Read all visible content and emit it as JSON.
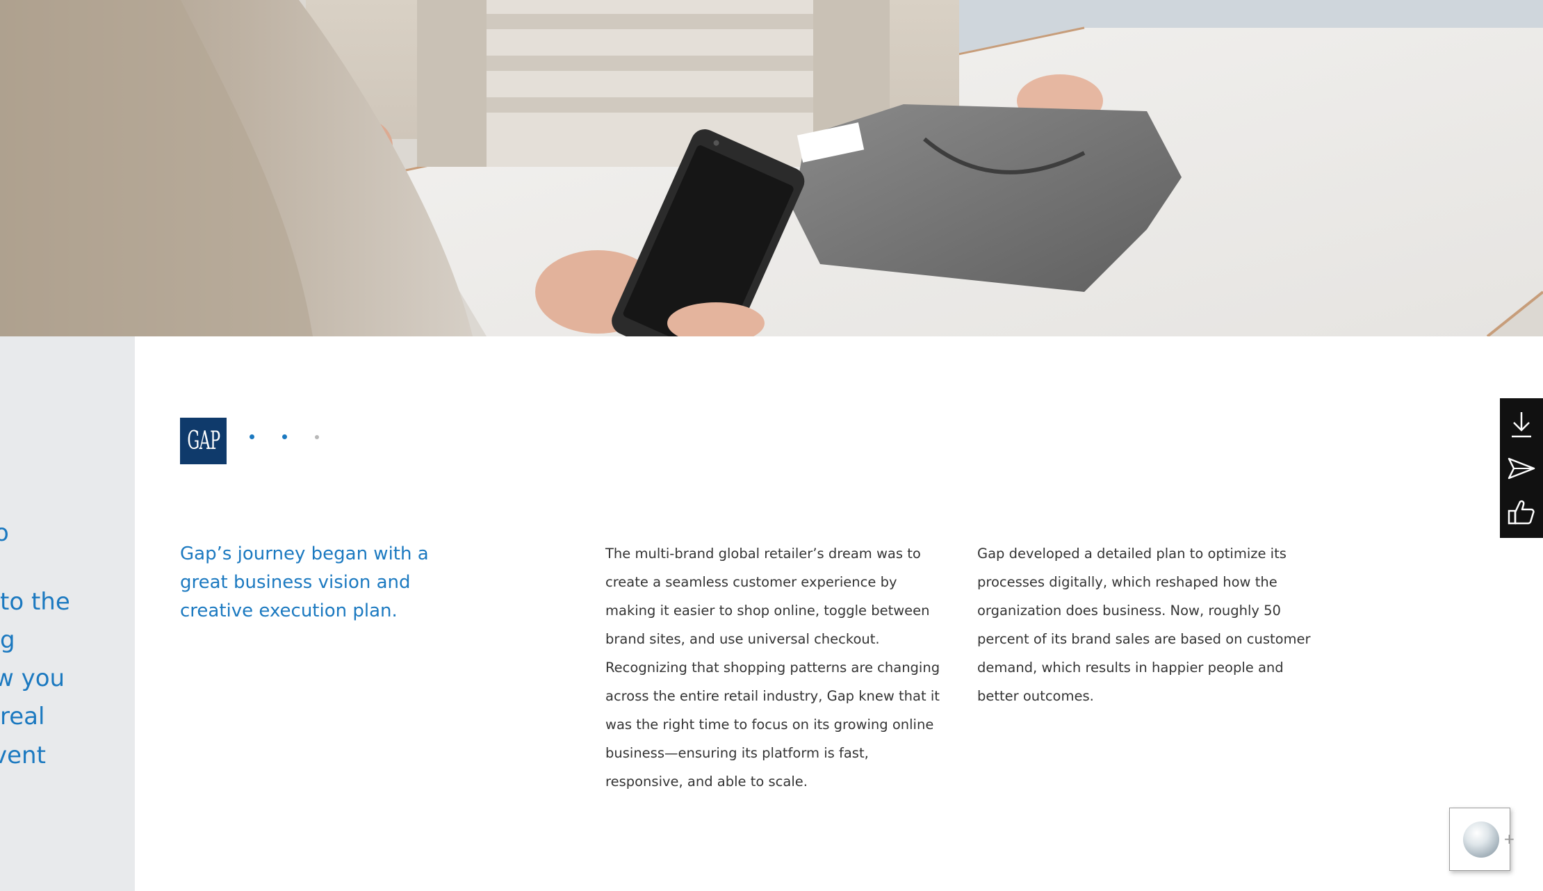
{
  "hero": {
    "alt": "Customer paying with phone at counter next to folded grey shirt"
  },
  "side_panel": {
    "lines": [
      "o",
      " to the",
      "g",
      "w you",
      "real",
      "vent"
    ]
  },
  "logo": {
    "text": "GAP",
    "bg_color": "#0f3a6b"
  },
  "carousel": {
    "dots": [
      {
        "active": true,
        "color": "#1b79c0"
      },
      {
        "active": true,
        "color": "#1b79c0"
      },
      {
        "active": false,
        "color": "#b8b8b8"
      }
    ]
  },
  "content": {
    "lead": "Gap’s journey began with a great business vision and creative execution plan.",
    "paragraph_1": "The multi-brand global retailer’s dream was to create a seamless customer experience by making it easier to shop online, toggle between brand sites, and use universal checkout. Recognizing that shopping patterns are changing across the entire retail industry, Gap knew that it was the right time to focus on its growing online business—ensuring its platform is fast, responsive, and able to scale.",
    "paragraph_2": "Gap developed a detailed plan to optimize its processes digitally, which reshaped how the organization does business. Now, roughly 50 percent of its brand sales are based on customer demand, which results in happier people and better outcomes."
  },
  "rail": {
    "items": [
      "download-icon",
      "send-icon",
      "thumbs-up-icon"
    ]
  },
  "chat": {
    "plus": "+"
  },
  "colors": {
    "accent": "#1b79c0",
    "text": "#333333",
    "side_panel_bg": "#e8eaec",
    "rail_bg": "#111111"
  }
}
